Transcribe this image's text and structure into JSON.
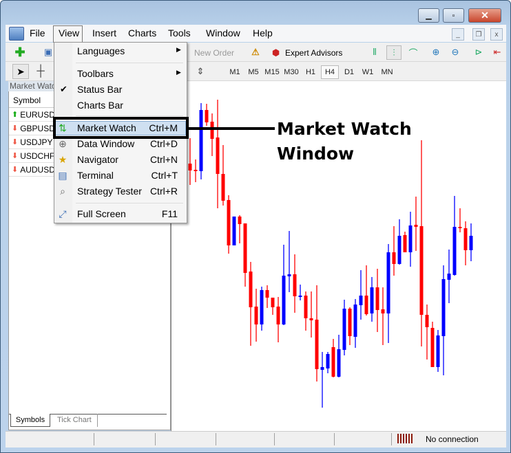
{
  "window": {
    "controls": {
      "minimize": "▁",
      "maximize": "▫",
      "close": "✕"
    },
    "mdi_controls": {
      "minimize": "_",
      "restore": "❐",
      "close": "x"
    }
  },
  "menubar": {
    "items": [
      "File",
      "View",
      "Insert",
      "Charts",
      "Tools",
      "Window",
      "Help"
    ]
  },
  "toolbar": {
    "new_order": "New Order",
    "expert_advisors": "Expert Advisors",
    "timeframes": [
      "M1",
      "M5",
      "M15",
      "M30",
      "H1",
      "H4",
      "D1",
      "W1",
      "MN"
    ],
    "active_timeframe": "H4"
  },
  "market_watch": {
    "title": "Market Watc",
    "column": "Symbol",
    "rows": [
      {
        "symbol": "EURUSD",
        "direction": "up"
      },
      {
        "symbol": "GBPUSD",
        "direction": "down"
      },
      {
        "symbol": "USDJPY",
        "direction": "down"
      },
      {
        "symbol": "USDCHF",
        "direction": "down"
      },
      {
        "symbol": "AUDUSD",
        "direction": "down"
      }
    ],
    "tabs": [
      "Symbols",
      "Tick Chart"
    ],
    "active_tab": "Symbols"
  },
  "view_menu": {
    "items": [
      {
        "label": "Languages",
        "submenu": true
      },
      {
        "label": "Toolbars",
        "submenu": true
      },
      {
        "label": "Status Bar",
        "checked": true
      },
      {
        "label": "Charts Bar"
      },
      {
        "label": "Market Watch",
        "shortcut": "Ctrl+M",
        "highlighted": true,
        "icon": "market-watch-icon"
      },
      {
        "label": "Data Window",
        "shortcut": "Ctrl+D",
        "icon": "crosshair-icon"
      },
      {
        "label": "Navigator",
        "shortcut": "Ctrl+N",
        "icon": "folder-star-icon"
      },
      {
        "label": "Terminal",
        "shortcut": "Ctrl+T",
        "icon": "terminal-icon"
      },
      {
        "label": "Strategy Tester",
        "shortcut": "Ctrl+R",
        "icon": "tester-icon"
      },
      {
        "label": "Full Screen",
        "shortcut": "F11",
        "icon": "fullscreen-icon"
      }
    ]
  },
  "annotation": {
    "line1": "Market Watch",
    "line2": "Window"
  },
  "status": {
    "connection": "No connection"
  },
  "colors": {
    "bull": "#0000ff",
    "bear": "#ff0000",
    "highlight": "#cfe0f1"
  },
  "chart_data": {
    "type": "candlestick",
    "candles": [
      [
        422,
        459,
        391,
        412
      ],
      [
        413,
        428,
        395,
        411
      ],
      [
        411,
        510,
        399,
        500
      ],
      [
        500,
        509,
        477,
        482
      ],
      [
        483,
        495,
        433,
        458
      ],
      [
        460,
        515,
        357,
        407
      ],
      [
        407,
        449,
        361,
        368
      ],
      [
        369,
        376,
        291,
        303
      ],
      [
        303,
        345,
        303,
        345
      ],
      [
        345,
        347,
        306,
        334
      ],
      [
        335,
        335,
        243,
        263
      ],
      [
        265,
        279,
        157,
        213
      ],
      [
        214,
        240,
        163,
        188
      ],
      [
        188,
        243,
        179,
        238
      ],
      [
        238,
        245,
        212,
        227
      ],
      [
        227,
        227,
        202,
        213
      ],
      [
        214,
        228,
        162,
        188
      ],
      [
        188,
        304,
        187,
        259
      ],
      [
        258,
        324,
        235,
        261
      ],
      [
        261,
        290,
        205,
        229
      ],
      [
        229,
        246,
        223,
        230
      ],
      [
        230,
        236,
        179,
        197
      ],
      [
        197,
        236,
        169,
        194
      ],
      [
        195,
        245,
        105,
        123
      ],
      [
        122,
        148,
        67,
        126
      ],
      [
        124,
        148,
        117,
        145
      ],
      [
        155,
        167,
        111,
        112
      ],
      [
        112,
        173,
        111,
        152
      ],
      [
        151,
        224,
        143,
        211
      ],
      [
        211,
        213,
        158,
        171
      ],
      [
        170,
        225,
        154,
        217
      ],
      [
        216,
        267,
        195,
        230
      ],
      [
        230,
        274,
        201,
        203
      ],
      [
        204,
        257,
        192,
        242
      ],
      [
        242,
        269,
        177,
        209
      ],
      [
        210,
        242,
        158,
        204
      ],
      [
        204,
        305,
        161,
        293
      ],
      [
        293,
        331,
        259,
        276
      ],
      [
        276,
        341,
        275,
        317
      ],
      [
        318,
        323,
        293,
        293
      ],
      [
        293,
        352,
        272,
        332
      ],
      [
        333,
        374,
        295,
        330
      ],
      [
        331,
        456,
        156,
        202
      ],
      [
        202,
        217,
        137,
        184
      ],
      [
        183,
        192,
        126,
        126
      ],
      [
        126,
        180,
        119,
        172
      ],
      [
        171,
        274,
        114,
        254
      ],
      [
        253,
        297,
        219,
        262
      ],
      [
        260,
        375,
        259,
        330
      ],
      [
        330,
        357,
        322,
        329
      ],
      [
        328,
        338,
        274,
        296
      ],
      [
        296,
        335,
        280,
        317
      ]
    ],
    "candle_format": [
      "open",
      "high",
      "low",
      "close"
    ]
  }
}
